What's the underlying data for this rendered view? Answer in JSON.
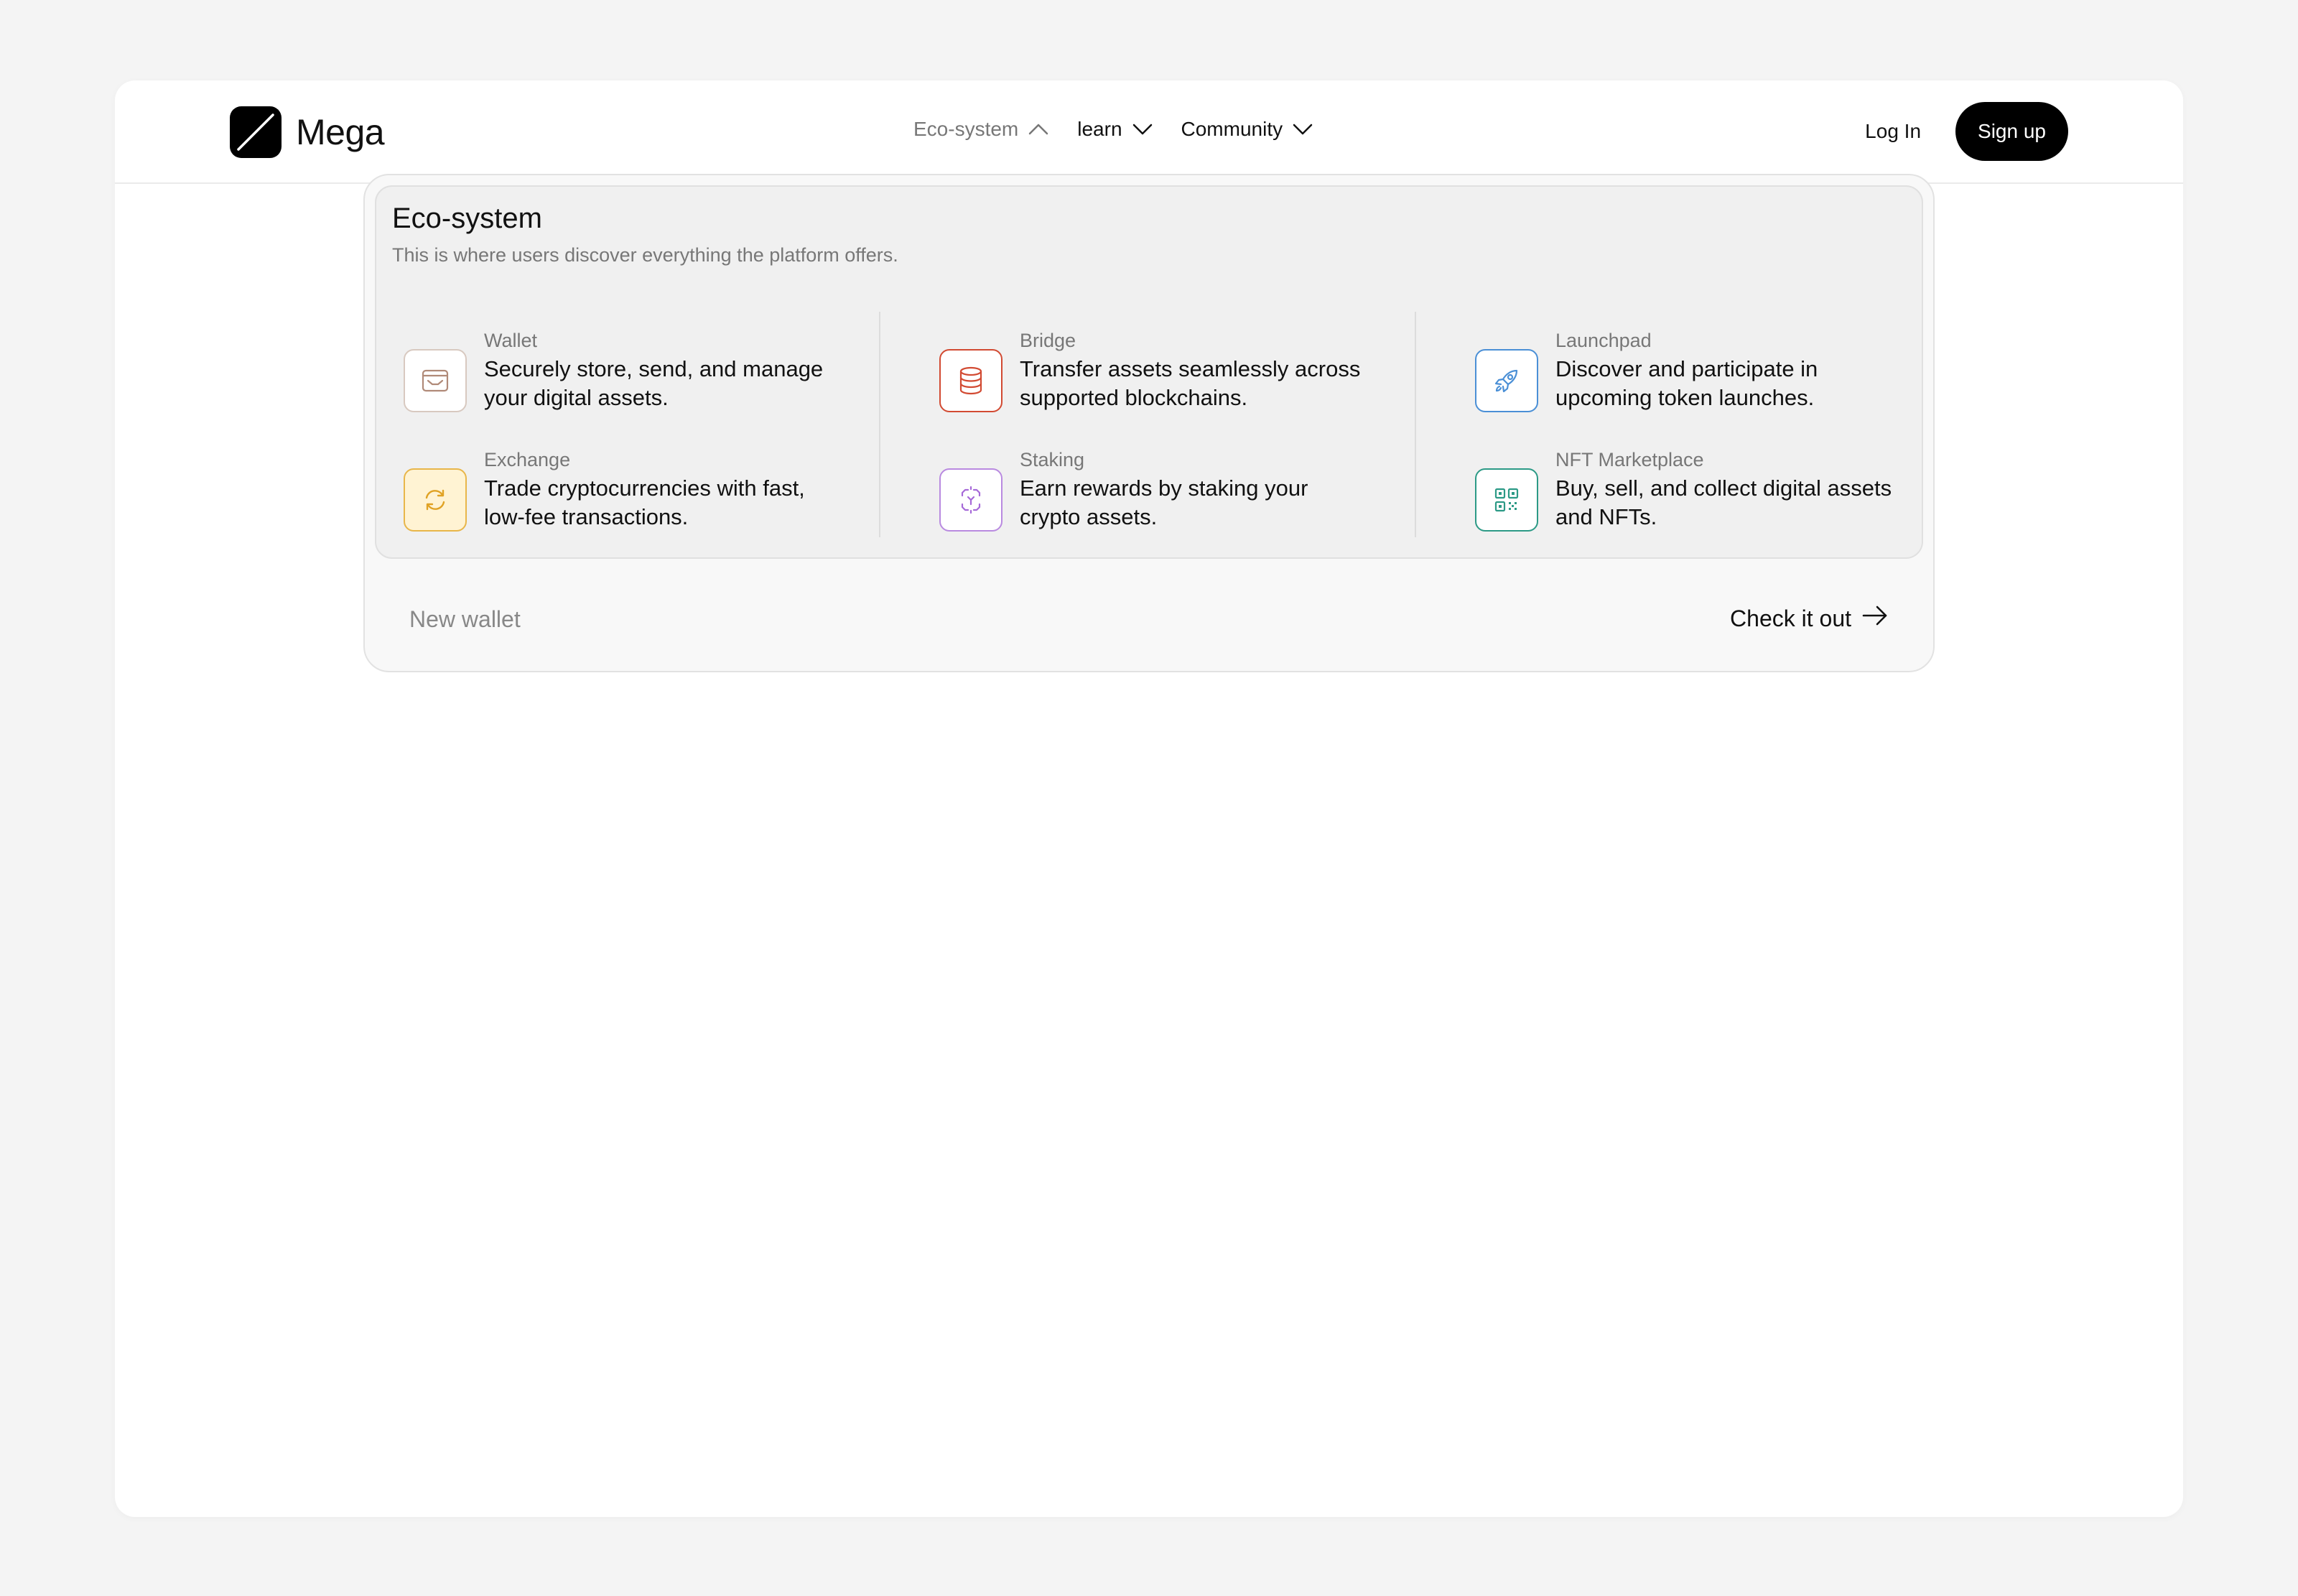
{
  "brand": {
    "name": "Mega",
    "logo_icon": "slash-logo-icon"
  },
  "nav": {
    "items": [
      {
        "label": "Eco-system",
        "icon": "chevron-up-icon",
        "active": true
      },
      {
        "label": "learn",
        "icon": "chevron-down-icon",
        "active": false
      },
      {
        "label": "Community",
        "icon": "chevron-down-icon",
        "active": false
      }
    ]
  },
  "auth": {
    "login_label": "Log In",
    "signup_label": "Sign up"
  },
  "dropdown": {
    "title": "Eco-system",
    "subtitle": "This is where users discover everything the platform offers.",
    "items": [
      {
        "name": "Wallet",
        "desc": "Securely store, send, and manage your digital assets.",
        "icon": "wallet-icon",
        "color": "#b08a78"
      },
      {
        "name": "Bridge",
        "desc": "Transfer assets seamlessly across supported blockchains.",
        "icon": "database-icon",
        "color": "#d24a32"
      },
      {
        "name": "Launchpad",
        "desc": "Discover and participate in upcoming token launches.",
        "icon": "rocket-icon",
        "color": "#4a8fd6"
      },
      {
        "name": "Exchange",
        "desc": "Trade cryptocurrencies with fast, low-fee transactions.",
        "icon": "refresh-icon",
        "color": "#e0a224"
      },
      {
        "name": "Staking",
        "desc": "Earn rewards by staking your crypto assets.",
        "icon": "focus-icon",
        "color": "#a66ad8"
      },
      {
        "name": "NFT Marketplace",
        "desc": "Buy, sell, and collect digital assets and NFTs.",
        "icon": "qr-code-icon",
        "color": "#2c9a86"
      }
    ],
    "footer": {
      "left_label": "New wallet",
      "right_label": "Check it out",
      "right_icon": "arrow-right-icon"
    }
  },
  "colors": {
    "background": "#f4f4f4",
    "surface": "#ffffff",
    "primary_button": "#000000",
    "muted_text": "#777777"
  }
}
